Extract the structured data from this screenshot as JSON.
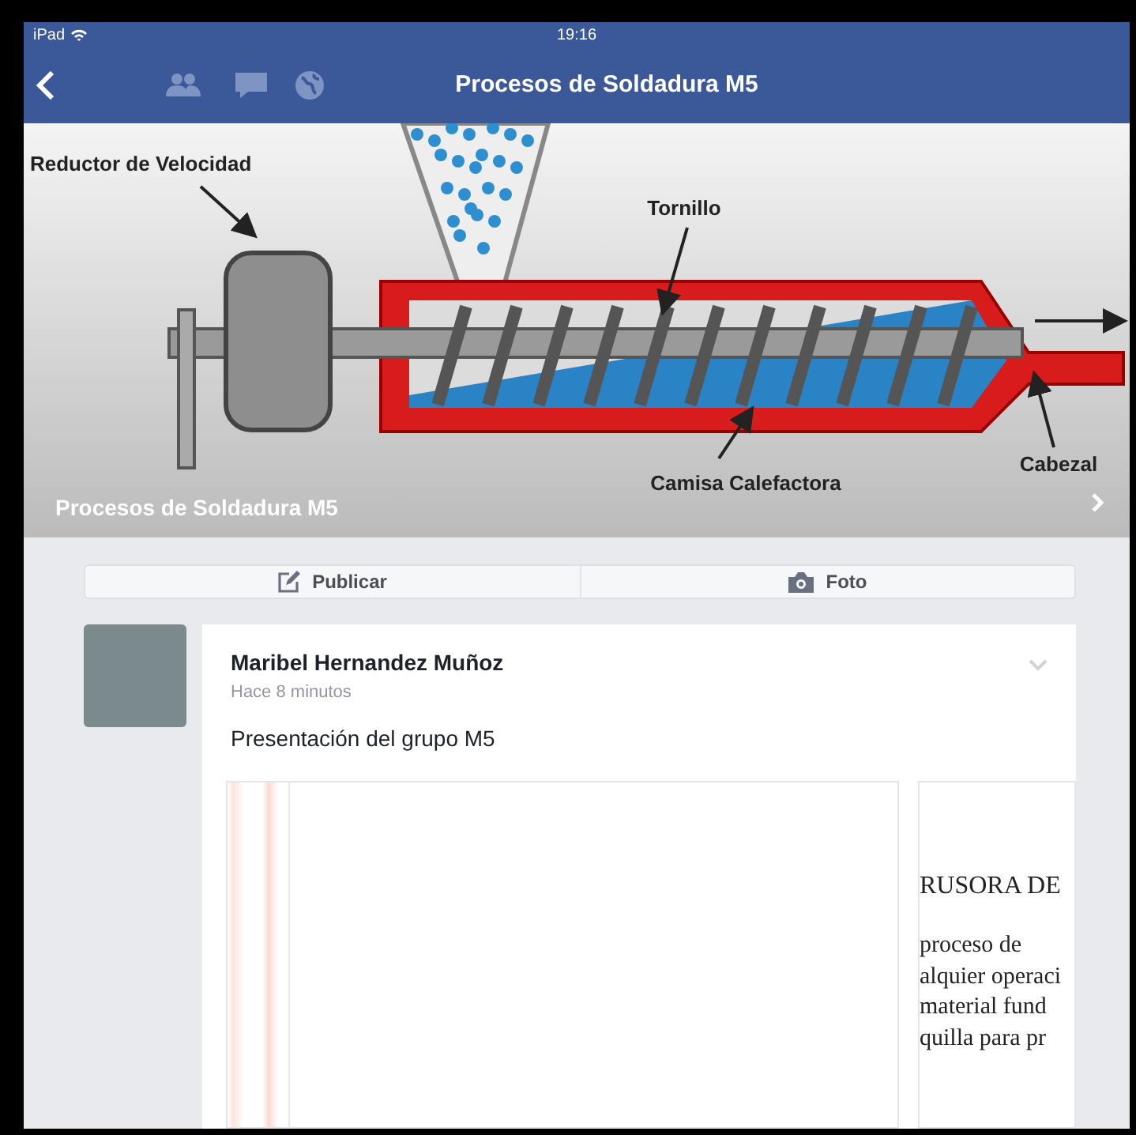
{
  "status_bar": {
    "device": "iPad",
    "time": "19:16"
  },
  "nav": {
    "title": "Procesos de Soldadura M5"
  },
  "cover": {
    "caption": "Procesos de Soldadura M5",
    "diagram_labels": [
      {
        "kind": "reducer",
        "text": "Reductor de Velocidad"
      },
      {
        "kind": "screw",
        "text": "Tornillo"
      },
      {
        "kind": "jacket",
        "text": "Camisa Calefactora"
      },
      {
        "kind": "head",
        "text": "Cabezal"
      }
    ]
  },
  "actions": [
    {
      "kind": "post",
      "label": "Publicar"
    },
    {
      "kind": "photo",
      "label": "Foto"
    }
  ],
  "post": {
    "author": "Maribel Hernandez Muñoz",
    "time": "Hace 8 minutos",
    "text": "Presentación del grupo M5",
    "document": {
      "heading": "RUSORA DE",
      "lines": [
        "proceso de",
        "alquier operaci",
        "material fund",
        "quilla para pr"
      ]
    }
  }
}
